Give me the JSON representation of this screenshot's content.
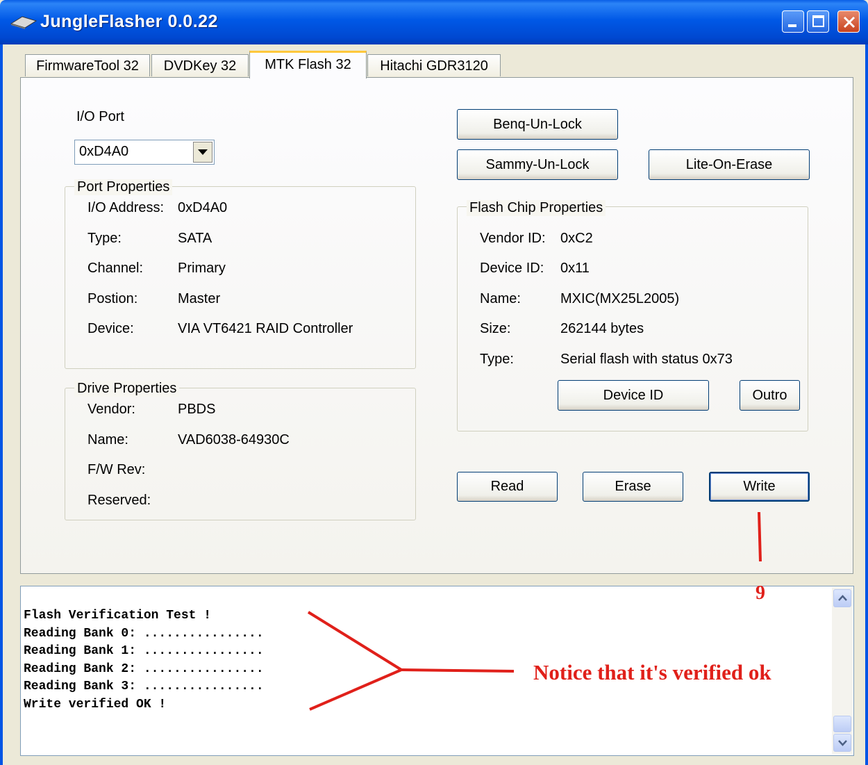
{
  "window": {
    "title": "JungleFlasher 0.0.22"
  },
  "tabs": [
    {
      "label": "FirmwareTool 32"
    },
    {
      "label": "DVDKey 32"
    },
    {
      "label": "MTK Flash 32"
    },
    {
      "label": "Hitachi GDR3120"
    }
  ],
  "active_tab": "MTK Flash 32",
  "io_port": {
    "label": "I/O Port",
    "selected": "0xD4A0"
  },
  "port_properties": {
    "title": "Port Properties",
    "rows": [
      {
        "label": "I/O Address:",
        "value": "0xD4A0"
      },
      {
        "label": "Type:",
        "value": "SATA"
      },
      {
        "label": "Channel:",
        "value": "Primary"
      },
      {
        "label": "Postion:",
        "value": "Master"
      },
      {
        "label": "Device:",
        "value": "VIA VT6421 RAID Controller"
      }
    ]
  },
  "drive_properties": {
    "title": "Drive Properties",
    "rows": [
      {
        "label": "Vendor:",
        "value": "PBDS"
      },
      {
        "label": "Name:",
        "value": "VAD6038-64930C"
      },
      {
        "label": "F/W Rev:",
        "value": ""
      },
      {
        "label": "Reserved:",
        "value": ""
      }
    ]
  },
  "unlock_buttons": {
    "benq": "Benq-Un-Lock",
    "sammy": "Sammy-Un-Lock",
    "liteon_erase": "Lite-On-Erase"
  },
  "flash_chip_properties": {
    "title": "Flash Chip Properties",
    "rows": [
      {
        "label": "Vendor ID:",
        "value": "0xC2"
      },
      {
        "label": "Device ID:",
        "value": "0x11"
      },
      {
        "label": "Name:",
        "value": "MXIC(MX25L2005)"
      },
      {
        "label": "Size:",
        "value": "262144 bytes"
      },
      {
        "label": "Type:",
        "value": "Serial flash with status 0x73"
      }
    ],
    "device_id_button": "Device ID",
    "outro_button": "Outro"
  },
  "actions": {
    "read": "Read",
    "erase": "Erase",
    "write": "Write"
  },
  "log": {
    "lines": [
      "Flash Verification Test !",
      "Reading Bank 0: ................",
      "Reading Bank 1: ................",
      "Reading Bank 2: ................",
      "Reading Bank 3: ................",
      "Write verified OK !"
    ]
  },
  "annotations": {
    "step_number": "9",
    "note": "Notice that it's verified ok",
    "color": "#E0201A"
  }
}
